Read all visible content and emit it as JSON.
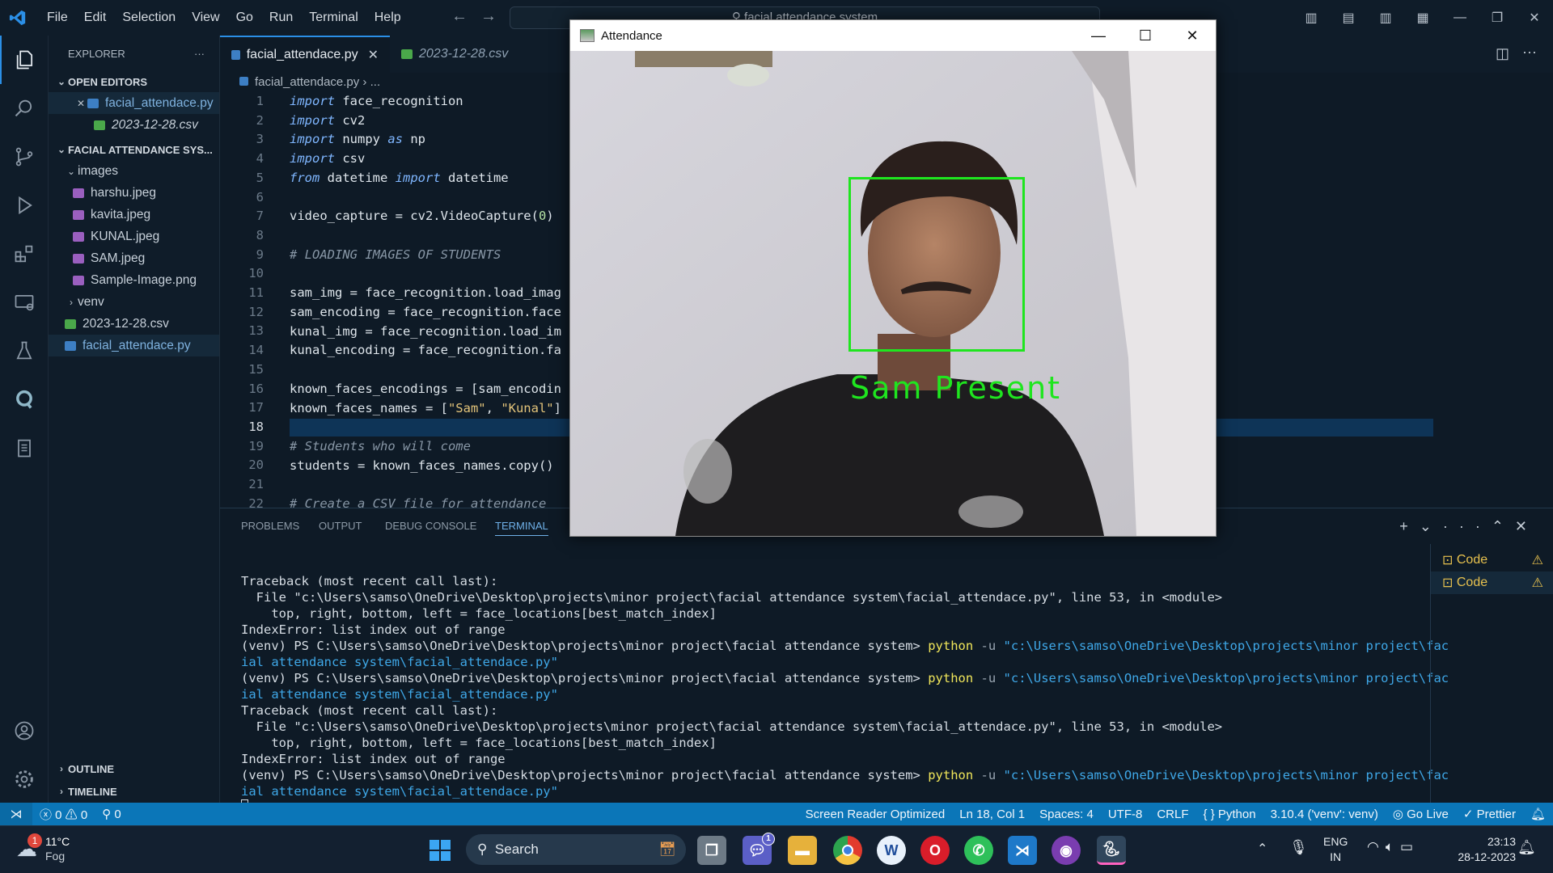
{
  "menu": [
    "File",
    "Edit",
    "Selection",
    "View",
    "Go",
    "Run",
    "Terminal",
    "Help"
  ],
  "search": "facial attendance system",
  "sidebar": {
    "title": "EXPLORER",
    "open_editors": "OPEN EDITORS",
    "open_files": [
      "facial_attendace.py",
      "2023-12-28.csv"
    ],
    "project": "FACIAL ATTENDANCE SYS...",
    "folder_images": "images",
    "images": [
      "harshu.jpeg",
      "kavita.jpeg",
      "KUNAL.jpeg",
      "SAM.jpeg",
      "Sample-Image.png"
    ],
    "folder_venv": "venv",
    "files": [
      "2023-12-28.csv",
      "facial_attendace.py"
    ],
    "outline": "OUTLINE",
    "timeline": "TIMELINE"
  },
  "tabs": [
    "facial_attendace.py",
    "2023-12-28.csv"
  ],
  "breadcrumb": [
    "facial_attendace.py",
    "..."
  ],
  "editor": {
    "line_numbers": [
      "1",
      "2",
      "3",
      "4",
      "5",
      "6",
      "7",
      "8",
      "9",
      "10",
      "11",
      "12",
      "13",
      "14",
      "15",
      "16",
      "17",
      "18",
      "19",
      "20",
      "21",
      "22"
    ],
    "l1_kw": "import",
    "l1": " face_recognition",
    "l2_kw": "import",
    "l2": " cv2",
    "l3_kw": "import",
    "l3a": " numpy ",
    "l3_as": "as",
    "l3b": " np",
    "l4_kw": "import",
    "l4": " csv",
    "l5_from": "from",
    "l5a": " datetime ",
    "l5_imp": "import",
    "l5b": " datetime",
    "l7": "video_capture = cv2.VideoCapture(",
    "l7_num": "0",
    "l7_end": ")",
    "l9": "# LOADING IMAGES OF STUDENTS",
    "l11": "sam_img = face_recognition.load_imag",
    "l12": "sam_encoding = face_recognition.face",
    "l13": "kunal_img = face_recognition.load_im",
    "l14": "kunal_encoding = face_recognition.fa",
    "l16": "known_faces_encodings = [sam_encodin",
    "l17a": "known_faces_names = [",
    "l17_s1": "\"Sam\"",
    "l17_c": ", ",
    "l17_s2": "\"Kunal\"",
    "l17_e": "]",
    "l19": "# Students who will come",
    "l20": "students = known_faces_names.copy()",
    "l22": "# Create a CSV file for attendance"
  },
  "panel": {
    "tabs": [
      "PROBLEMS",
      "OUTPUT",
      "DEBUG CONSOLE",
      "TERMINAL"
    ],
    "terminals": [
      "Code",
      "Code"
    ]
  },
  "terminal": {
    "l1": "Traceback (most recent call last):",
    "l2": "  File \"c:\\Users\\samso\\OneDrive\\Desktop\\projects\\minor project\\facial attendance system\\facial_attendace.py\", line 53, in <module>",
    "l3": "    top, right, bottom, left = face_locations[best_match_index]",
    "l4": "IndexError: list index out of range",
    "prompt": "(venv) PS C:\\Users\\samso\\OneDrive\\Desktop\\projects\\minor project\\facial attendance system> ",
    "cmd": "python",
    "flag": " -u ",
    "path1": "\"c:\\Users\\samso\\OneDrive\\Desktop\\projects\\minor project\\fac",
    "path2": "ial attendance system\\facial_attendace.py\""
  },
  "status": {
    "errors": "0",
    "warnings": "0",
    "ports": "0",
    "screen_reader": "Screen Reader Optimized",
    "position": "Ln 18, Col 1",
    "spaces": "Spaces: 4",
    "encoding": "UTF-8",
    "eol": "CRLF",
    "language": "Python",
    "interpreter": "3.10.4 ('venv': venv)",
    "golive": "Go Live",
    "prettier": "Prettier"
  },
  "attendance_window": {
    "title": "Attendance",
    "label": "Sam Present"
  },
  "taskbar": {
    "weather_temp": "11°C",
    "weather_desc": "Fog",
    "weather_badge": "1",
    "search": "Search",
    "lang1": "ENG",
    "lang2": "IN",
    "time": "23:13",
    "date": "28-12-2023",
    "teams_badge": "1"
  },
  "colors": {
    "accent": "#0b76b8",
    "face_box": "#1fe51f"
  }
}
